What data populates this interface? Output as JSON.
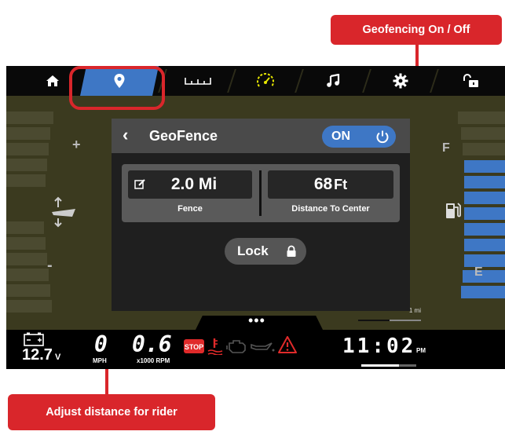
{
  "callouts": {
    "top": "Geofencing On / Off",
    "bottom": "Adjust distance for rider"
  },
  "tabs": [
    {
      "icon": "home-icon",
      "active": false
    },
    {
      "icon": "location-pin-icon",
      "active": true
    },
    {
      "icon": "ruler-icon",
      "active": false
    },
    {
      "icon": "speedometer-icon",
      "active": false
    },
    {
      "icon": "music-note-icon",
      "active": false
    },
    {
      "icon": "gear-icon",
      "active": false
    },
    {
      "icon": "unlock-icon",
      "active": false
    }
  ],
  "left_gauge": {
    "plus": "+",
    "minus": "-"
  },
  "right_gauge": {
    "full": "F",
    "empty": "E"
  },
  "panel": {
    "title": "GeoFence",
    "toggle_label": "ON",
    "fence_value": "2.0 Mi",
    "fence_label": "Fence",
    "distance_value": "68",
    "distance_unit": "Ft",
    "distance_label": "Distance To Center",
    "lock_label": "Lock"
  },
  "map_scale": "1 mi",
  "status": {
    "battery_value": "12.7",
    "battery_unit": "V",
    "speed_value": "0",
    "speed_unit": "MPH",
    "rpm_value": "0.6",
    "rpm_unit": "x1000 RPM",
    "time": "11:02",
    "time_suffix": "PM"
  },
  "colors": {
    "accent_red": "#d9262b",
    "active_blue": "#3e77c5",
    "screen_bg": "#3b3a1f",
    "warning_red": "#e02a2a"
  }
}
